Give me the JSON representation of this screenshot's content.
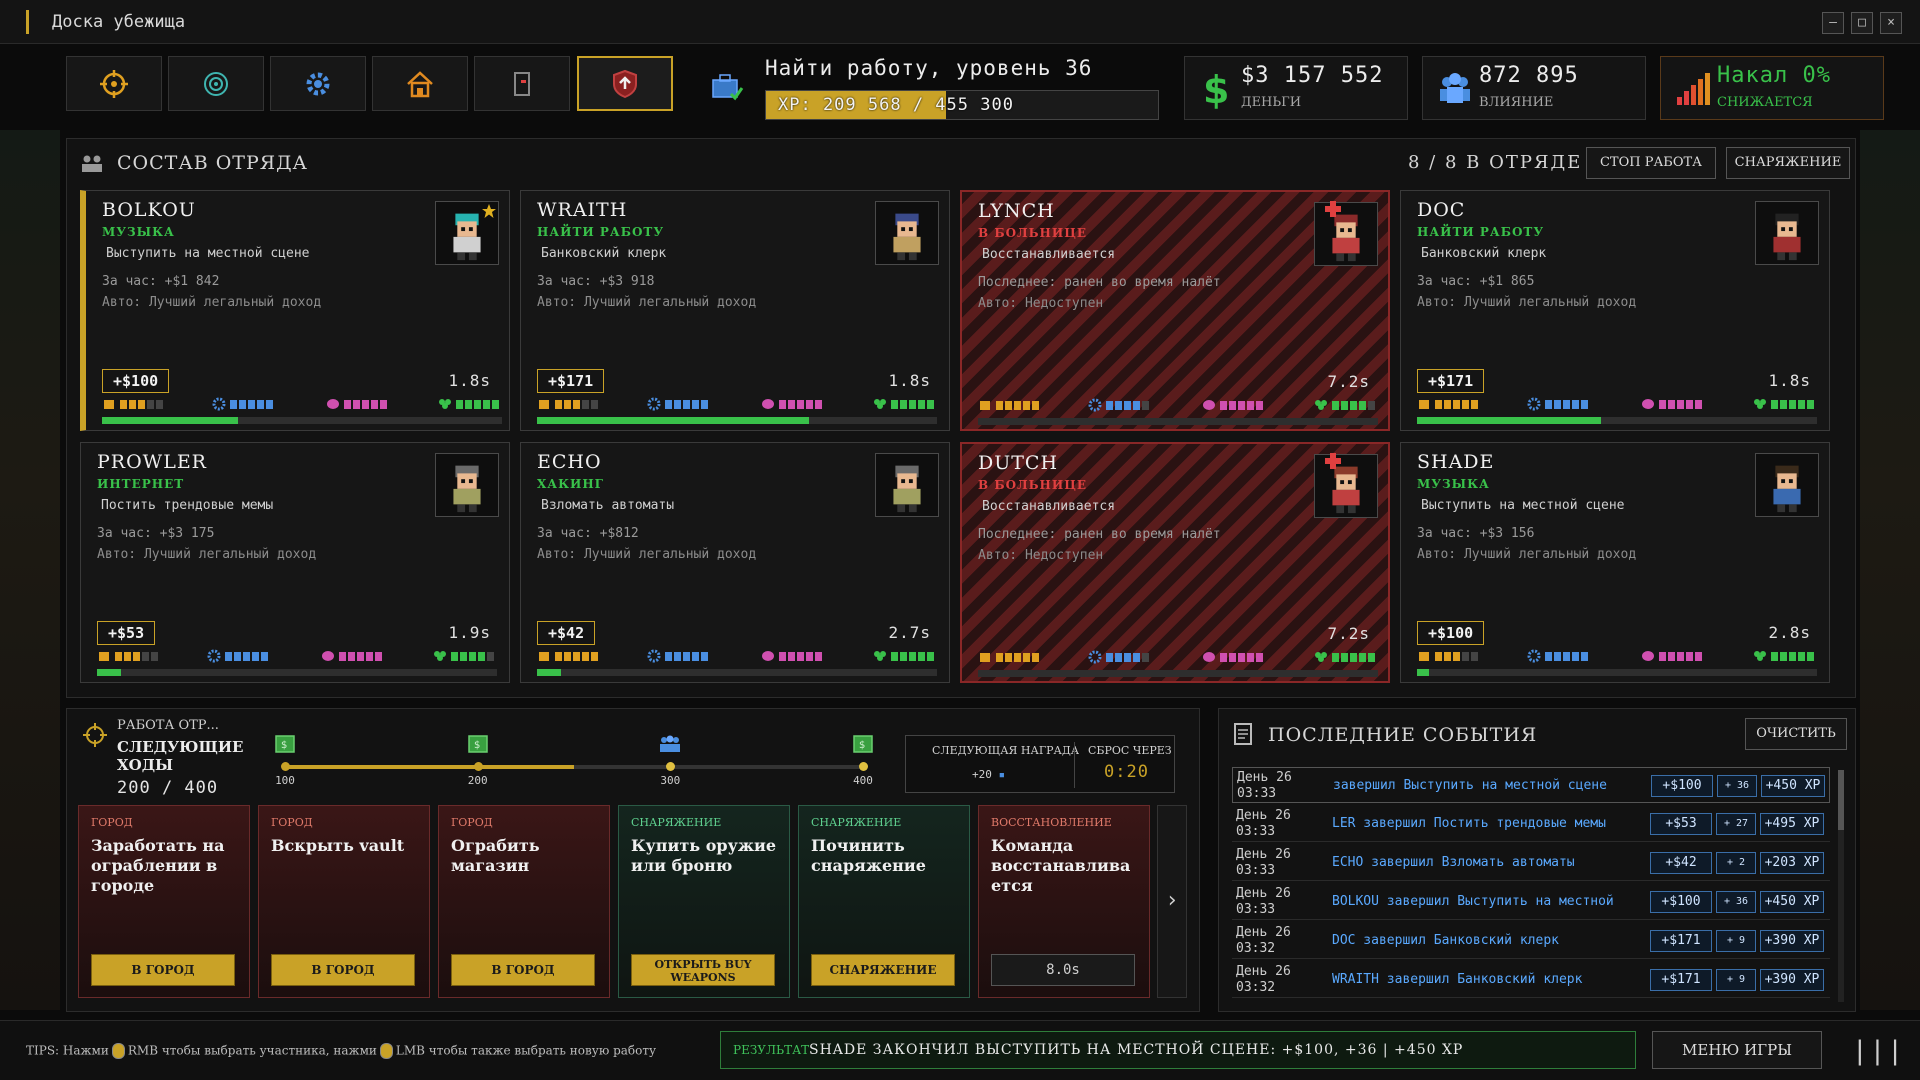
{
  "window": {
    "title": "Доска убежища"
  },
  "nav": [
    "target-icon",
    "radar-icon",
    "gear-icon",
    "house-icon",
    "phone-icon",
    "shield-icon"
  ],
  "job": {
    "title": "Найти работу, уровень 36",
    "xp_text": "XP: 209 568 / 455 300",
    "xp_current": 209568,
    "xp_max": 455300
  },
  "stats": {
    "money": {
      "value": "$3 157 552",
      "label": "ДЕНЬГИ"
    },
    "influence": {
      "value": "872 895",
      "label": "ВЛИЯНИЕ"
    },
    "heat": {
      "value": "Накал 0%",
      "label": "СНИЖАЕТСЯ"
    }
  },
  "squad": {
    "title": "СОСТАВ ОТРЯДА",
    "count": "8 / 8 В ОТРЯДЕ",
    "stop_label": "СТОП РАБОТА",
    "gear_label": "СНАРЯЖЕНИЕ",
    "members": [
      {
        "name": "BOLKOU",
        "job": "МУЗЫКА",
        "task": "Выступить на местной сцене",
        "rate": "За час: +$1 842",
        "auto": "Авто: Лучший легальный доход",
        "earn": "+$100",
        "time": "1.8s",
        "progress": 0.34,
        "status": "work",
        "selected": true,
        "star": true
      },
      {
        "name": "WRAITH",
        "job": "НАЙТИ РАБОТУ",
        "task": "Банковский клерк",
        "rate": "За час: +$3 918",
        "auto": "Авто: Лучший легальный доход",
        "earn": "+$171",
        "time": "1.8s",
        "progress": 0.68,
        "status": "work"
      },
      {
        "name": "LYNCH",
        "job": "В БОЛЬНИЦЕ",
        "task": "Восстанавливается",
        "rate": "Последнее: ранен во время налёт",
        "auto": "Авто: Недоступен",
        "earn": "",
        "time": "7.2s",
        "progress": 0,
        "status": "hospital"
      },
      {
        "name": "DOC",
        "job": "НАЙТИ РАБОТУ",
        "task": "Банковский клерк",
        "rate": "За час: +$1 865",
        "auto": "Авто: Лучший легальный доход",
        "earn": "+$171",
        "time": "1.8s",
        "progress": 0.46,
        "status": "work"
      },
      {
        "name": "PROWLER",
        "job": "ИНТЕРНЕТ",
        "task": "Постить трендовые мемы",
        "rate": "За час: +$3 175",
        "auto": "Авто: Лучший легальный доход",
        "earn": "+$53",
        "time": "1.9s",
        "progress": 0.06,
        "status": "work"
      },
      {
        "name": "ECHO",
        "job": "ХАКИНГ",
        "task": "Взломать автоматы",
        "rate": "За час: +$812",
        "auto": "Авто: Лучший легальный доход",
        "earn": "+$42",
        "time": "2.7s",
        "progress": 0.06,
        "status": "work"
      },
      {
        "name": "DUTCH",
        "job": "В БОЛЬНИЦЕ",
        "task": "Восстанавливается",
        "rate": "Последнее: ранен во время налёт",
        "auto": "Авто: Недоступен",
        "earn": "",
        "time": "7.2s",
        "progress": 0,
        "status": "hospital"
      },
      {
        "name": "SHADE",
        "job": "МУЗЫКА",
        "task": "Выступить на местной сцене",
        "rate": "За час: +$3 156",
        "auto": "Авто: Лучший легальный доход",
        "earn": "+$100",
        "time": "2.8s",
        "progress": 0.03,
        "status": "work"
      }
    ]
  },
  "missions": {
    "label": "РАБОТА ОТР...",
    "next": "СЛЕДУЮЩИЕ ХОДЫ",
    "count": "200 / 400",
    "progress": 200,
    "max": 400,
    "track_ticks": [
      "100",
      "200",
      "300",
      "400"
    ],
    "reward": {
      "label": "СЛЕДУЮЩАЯ НАГРАДА",
      "value": "+20",
      "reset_label": "СБРОС ЧЕРЕЗ",
      "reset_value": "0:20"
    },
    "cards": [
      {
        "tag": "ГОРОД",
        "name": "Заработать на ограблении в городе",
        "button": "В ГОРОД",
        "kind": "city"
      },
      {
        "tag": "ГОРОД",
        "name": "Вскрыть vault",
        "button": "В ГОРОД",
        "kind": "city"
      },
      {
        "tag": "ГОРОД",
        "name": "Ограбить магазин",
        "button": "В ГОРОД",
        "kind": "city"
      },
      {
        "tag": "СНАРЯЖЕНИЕ",
        "name": "Купить оружие или броню",
        "button": "ОТКРЫТЬ BUY WEAPONS",
        "kind": "gear"
      },
      {
        "tag": "СНАРЯЖЕНИЕ",
        "name": "Починить снаряжение",
        "button": "СНАРЯЖЕНИЕ",
        "kind": "gear"
      },
      {
        "tag": "ВОССТАНОВЛЕНИЕ",
        "name": "Команда восстанавлива ется",
        "button": "8.0s",
        "kind": "rec"
      }
    ]
  },
  "events": {
    "title": "ПОСЛЕДНИЕ СОБЫТИЯ",
    "clear_label": "ОЧИСТИТЬ",
    "rows": [
      {
        "day": "День 26",
        "time": "03:33",
        "text": "завершил Выступить на местной сцене",
        "money": "+$100",
        "inf": "+ 36",
        "xp": "+450 XP"
      },
      {
        "day": "День 26",
        "time": "03:33",
        "text": "LER завершил Постить трендовые мемы",
        "money": "+$53",
        "inf": "+ 27",
        "xp": "+495 XP"
      },
      {
        "day": "День 26",
        "time": "03:33",
        "text": "ECHO завершил Взломать автоматы",
        "money": "+$42",
        "inf": "+ 2",
        "xp": "+203 XP"
      },
      {
        "day": "День 26",
        "time": "03:33",
        "text": "BOLKOU завершил Выступить на местной",
        "money": "+$100",
        "inf": "+ 36",
        "xp": "+450 XP"
      },
      {
        "day": "День 26",
        "time": "03:32",
        "text": "DOC завершил Банковский клерк",
        "money": "+$171",
        "inf": "+ 9",
        "xp": "+390 XP"
      },
      {
        "day": "День 26",
        "time": "03:32",
        "text": "WRAITH завершил Банковский клерк",
        "money": "+$171",
        "inf": "+ 9",
        "xp": "+390 XP"
      }
    ]
  },
  "footer": {
    "tips_a": "TIPS: Нажми",
    "tips_b": "RMB чтобы выбрать участника, нажми",
    "tips_c": "LMB чтобы также выбрать новую работу",
    "result_label": "РЕЗУЛЬТАТ",
    "result_text": "SHADE ЗАКОНЧИЛ ВЫСТУПИТЬ НА МЕСТНОЙ СЦЕНЕ: +$100, +36 | +450 XP",
    "menu_label": "МЕНЮ ИГРЫ",
    "bars": "|||"
  },
  "colors": {
    "accent": "#c9a227",
    "green": "#39c14a",
    "red": "#e04040",
    "blue": "#4a8ee0",
    "pink": "#d050b0"
  }
}
